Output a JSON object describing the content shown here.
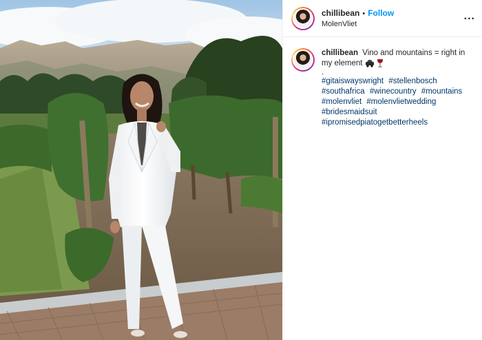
{
  "post": {
    "username": "chillibean",
    "separator": "•",
    "follow_label": "Follow",
    "location": "MolenVliet",
    "more_label": "...",
    "caption": {
      "username": "chillibean",
      "text": "Vino and mountains = right in my element",
      "emojis": [
        "lady-beetle-car-icon",
        "wine-glass-icon"
      ],
      "separator_dot": ".",
      "hashtags": [
        "#gitaiswayswright",
        "#stellenbosch",
        "#southafrica",
        "#winecountry",
        "#mountains",
        "#molenvliet",
        "#molenvlietwedding",
        "#bridesmaidsuit",
        "#ipromisedpiatogetbetterheels"
      ]
    }
  },
  "colors": {
    "link": "#0095f6",
    "hashtag": "#00376b",
    "text": "#262626",
    "border": "#efefef"
  }
}
